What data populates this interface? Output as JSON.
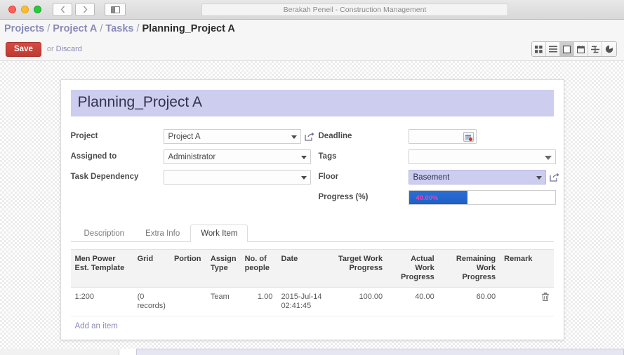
{
  "browser": {
    "title": "Berakah Peneil - Construction Management",
    "back_icon": "chevron-left-icon",
    "forward_icon": "chevron-right-icon",
    "sidebar_icon": "sidebar-toggle-icon"
  },
  "breadcrumb": {
    "items": [
      {
        "label": "Projects",
        "current": false
      },
      {
        "label": "Project A",
        "current": false
      },
      {
        "label": "Tasks",
        "current": false
      },
      {
        "label": "Planning_Project A",
        "current": true
      }
    ],
    "separator": "/"
  },
  "action_bar": {
    "save_label": "Save",
    "or_label": "or",
    "discard_label": "Discard",
    "views": [
      {
        "name": "kanban",
        "title": "Kanban",
        "active": false
      },
      {
        "name": "list",
        "title": "List",
        "active": false
      },
      {
        "name": "form",
        "title": "Form",
        "active": true
      },
      {
        "name": "calendar",
        "title": "Calendar",
        "active": false
      },
      {
        "name": "gantt",
        "title": "Gantt",
        "active": false
      },
      {
        "name": "graph",
        "title": "Graph",
        "active": false
      }
    ]
  },
  "record": {
    "title": "Planning_Project A"
  },
  "form": {
    "left": [
      {
        "label": "Project",
        "value": "Project A",
        "type": "select-link",
        "highlight": false
      },
      {
        "label": "Assigned to",
        "value": "Administrator",
        "type": "select",
        "highlight": false
      },
      {
        "label": "Task Dependency",
        "value": "",
        "type": "select",
        "highlight": false
      }
    ],
    "right": {
      "deadline": {
        "label": "Deadline",
        "value": ""
      },
      "tags": {
        "label": "Tags",
        "value": ""
      },
      "floor": {
        "label": "Floor",
        "value": "Basement"
      },
      "progress": {
        "label": "Progress (%)",
        "value": "40.00%",
        "percent": 40
      }
    }
  },
  "tabs": [
    {
      "label": "Description",
      "active": false
    },
    {
      "label": "Extra Info",
      "active": false
    },
    {
      "label": "Work Item",
      "active": true
    }
  ],
  "work_items": {
    "columns": [
      "Men Power Est. Template",
      "Grid",
      "Portion",
      "Assign Type",
      "No. of people",
      "Date",
      "Target Work Progress",
      "Actual Work Progress",
      "Remaining Work Progress",
      "Remark"
    ],
    "rows": [
      {
        "template": "1:200",
        "grid": "(0 records)",
        "portion": "",
        "assign_type": "Team",
        "people": "1.00",
        "date": "2015-Jul-14 02:41:45",
        "target": "100.00",
        "actual": "40.00",
        "remaining": "60.00",
        "remark": "",
        "delete_icon": "trash-icon"
      }
    ],
    "add_label": "Add an item"
  },
  "colors": {
    "accent": "#8a8ab8",
    "title_bg": "#cdcdf0",
    "save_red": "#be3a32",
    "progress_blue": "#1d5fc4",
    "progress_text": "#ff3db0"
  }
}
